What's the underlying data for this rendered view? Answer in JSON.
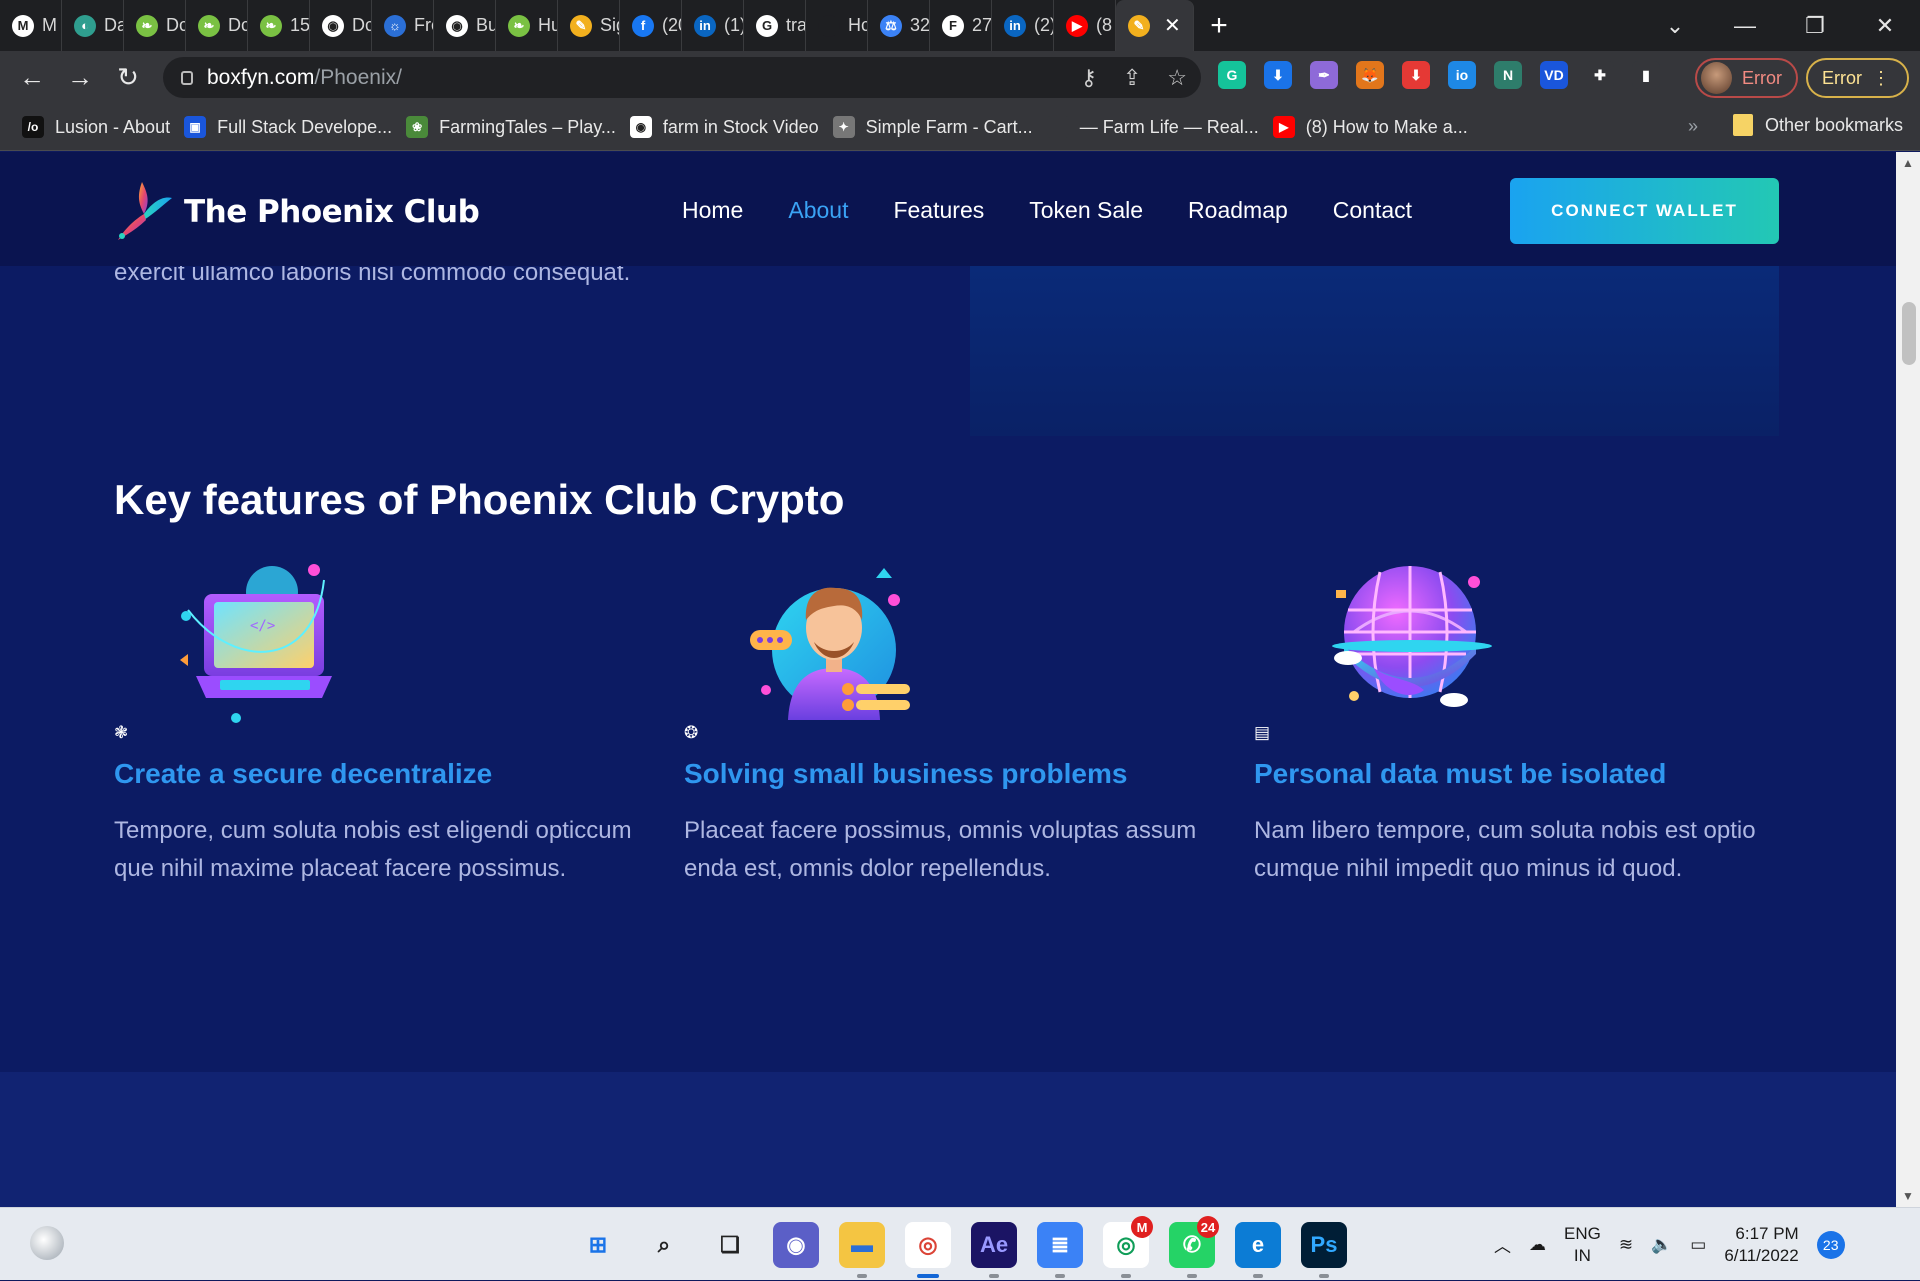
{
  "browser": {
    "tabs": [
      {
        "label": "M",
        "color": "#ffffff",
        "glyph": "M"
      },
      {
        "label": "Da",
        "color": "#2f9e8f",
        "glyph": "◐"
      },
      {
        "label": "Dc",
        "color": "#7ac143",
        "glyph": "❧"
      },
      {
        "label": "Dc",
        "color": "#7ac143",
        "glyph": "❧"
      },
      {
        "label": "15",
        "color": "#7ac143",
        "glyph": "❧"
      },
      {
        "label": "Dc",
        "color": "#ffffff",
        "glyph": "◉"
      },
      {
        "label": "Fre",
        "color": "#2b6fd6",
        "glyph": "☼"
      },
      {
        "label": "Bu",
        "color": "#ffffff",
        "glyph": "◉"
      },
      {
        "label": "Hu",
        "color": "#7ac143",
        "glyph": "❧"
      },
      {
        "label": "Sig",
        "color": "#f2b01e",
        "glyph": "✎"
      },
      {
        "label": "(20",
        "color": "#1877f2",
        "glyph": "f"
      },
      {
        "label": "(1)",
        "color": "#0a66c2",
        "glyph": "in"
      },
      {
        "label": "tra",
        "color": "#ffffff",
        "glyph": "G"
      },
      {
        "label": "Hc",
        "color": "#1e1f22",
        "glyph": ""
      },
      {
        "label": "32",
        "color": "#3b82f6",
        "glyph": "⚖"
      },
      {
        "label": "27",
        "color": "#ffffff",
        "glyph": "F"
      },
      {
        "label": "(2)",
        "color": "#0a66c2",
        "glyph": "in"
      },
      {
        "label": "(8",
        "color": "#ff0000",
        "glyph": "▶"
      }
    ],
    "active_tab": {
      "color": "#f2b01e",
      "glyph": "✎",
      "close": "✕"
    },
    "new_tab": "+",
    "window_controls": {
      "minimize": "—",
      "restore": "❐",
      "close": "✕"
    },
    "nav": {
      "back": "←",
      "forward": "→",
      "reload": "↻"
    },
    "url": {
      "host": "boxfyn.com",
      "path": "/Phoenix/"
    },
    "omnibox_icons": [
      "key-icon",
      "share-icon",
      "star-icon"
    ],
    "extensions": [
      {
        "name": "grammarly-icon",
        "color": "#15c39a",
        "glyph": "G"
      },
      {
        "name": "download-icon",
        "color": "#1a73e8",
        "glyph": "⬇"
      },
      {
        "name": "feather-icon",
        "color": "#8e6ad8",
        "glyph": "✒"
      },
      {
        "name": "metamask-icon",
        "color": "#e2761b",
        "glyph": "🦊"
      },
      {
        "name": "downloader-icon",
        "color": "#e53935",
        "glyph": "⬇"
      },
      {
        "name": "io-icon",
        "color": "#1e88e5",
        "glyph": "io"
      },
      {
        "name": "n-icon",
        "color": "#2e7d6b",
        "glyph": "N"
      },
      {
        "name": "vd-icon",
        "color": "#1a56db",
        "glyph": "VD"
      },
      {
        "name": "puzzle-icon",
        "color": "#35363a",
        "glyph": "✚"
      },
      {
        "name": "sidepanel-icon",
        "color": "#35363a",
        "glyph": "▮"
      }
    ],
    "profile_error": "Error",
    "update_error": "Error",
    "menu": "⋮",
    "bookmarks": [
      {
        "label": "Lusion - About",
        "color": "#111111",
        "glyph": "/o"
      },
      {
        "label": "Full Stack Develope...",
        "color": "#1a56db",
        "glyph": "▣"
      },
      {
        "label": "FarmingTales – Play...",
        "color": "#4a8a3a",
        "glyph": "❀"
      },
      {
        "label": "farm in Stock Video",
        "color": "#ffffff",
        "glyph": "◉"
      },
      {
        "label": "Simple Farm - Cart...",
        "color": "#777777",
        "glyph": "✦"
      },
      {
        "label": "— Farm Life — Real...",
        "color": "#35363a",
        "glyph": ""
      },
      {
        "label": "(8) How to Make a...",
        "color": "#ff0000",
        "glyph": "▶"
      }
    ],
    "bookmarks_more": "»",
    "other_bookmarks": "Other bookmarks"
  },
  "site": {
    "brand": "The Phoenix Club",
    "nav": [
      "Home",
      "About",
      "Features",
      "Token Sale",
      "Roadmap",
      "Contact"
    ],
    "active_nav": "About",
    "cta": "CONNECT WALLET",
    "prev_section_text": "exercit ullamco laboris nisi commodo consequat.",
    "features_title": "Key features of Phoenix Club Crypto",
    "features": [
      {
        "title": "Create a secure decentralize",
        "desc": "Tempore, cum soluta nobis est eligendi opticcum que nihil maxime placeat facere possimus.",
        "icon": "network-icon",
        "glyph": "❃",
        "art": "laptop-illustration"
      },
      {
        "title": "Solving small business problems",
        "desc": "Placeat facere possimus, omnis voluptas assum enda est, omnis dolor repellendus.",
        "icon": "settings-icon",
        "glyph": "❂",
        "art": "businessman-illustration"
      },
      {
        "title": "Personal data must be isolated",
        "desc": "Nam libero tempore, cum soluta nobis est optio cumque nihil impedit quo minus id quod.",
        "icon": "database-icon",
        "glyph": "▤",
        "art": "globe-illustration"
      }
    ],
    "colors": {
      "bg": "#0c1b63",
      "header": "#0a1450",
      "accent": "#2f97ef",
      "cta_start": "#1aa3f0",
      "cta_end": "#23c8b4"
    }
  },
  "taskbar": {
    "apps": [
      {
        "name": "start-icon",
        "color": "#e6eaf0",
        "glyph": "⊞",
        "fg": "#1a73e8"
      },
      {
        "name": "search-icon",
        "color": "#e6eaf0",
        "glyph": "⌕",
        "fg": "#222222"
      },
      {
        "name": "task-view-icon",
        "color": "#e6eaf0",
        "glyph": "❏",
        "fg": "#222222"
      },
      {
        "name": "chat-icon",
        "color": "#5b5fc7",
        "glyph": "◉",
        "fg": "#ffffff"
      },
      {
        "name": "file-explorer-icon",
        "color": "#f4c542",
        "glyph": "▬",
        "fg": "#2b6fd6"
      },
      {
        "name": "chrome-icon",
        "color": "#ffffff",
        "glyph": "◎",
        "fg": "#db4437",
        "active": true
      },
      {
        "name": "after-effects-icon",
        "color": "#1b1464",
        "glyph": "Ae",
        "fg": "#9999ff"
      },
      {
        "name": "notepad-icon",
        "color": "#3b82f6",
        "glyph": "≣",
        "fg": "#ffffff"
      },
      {
        "name": "chrome-profile-icon",
        "color": "#ffffff",
        "glyph": "◎",
        "fg": "#0f9d58",
        "badge": "M"
      },
      {
        "name": "whatsapp-icon",
        "color": "#25d366",
        "glyph": "✆",
        "fg": "#ffffff",
        "badge": "24"
      },
      {
        "name": "edge-icon",
        "color": "#0c7cd5",
        "glyph": "e",
        "fg": "#ffffff"
      },
      {
        "name": "photoshop-icon",
        "color": "#001e36",
        "glyph": "Ps",
        "fg": "#31a8ff"
      }
    ],
    "language": [
      "ENG",
      "IN"
    ],
    "time": "6:17 PM",
    "date": "6/11/2022",
    "notifications": "23",
    "tray_icons": {
      "chevron": "︿",
      "cloud": "☁",
      "wifi": "≋",
      "volume": "🔈",
      "battery": "▭"
    }
  }
}
